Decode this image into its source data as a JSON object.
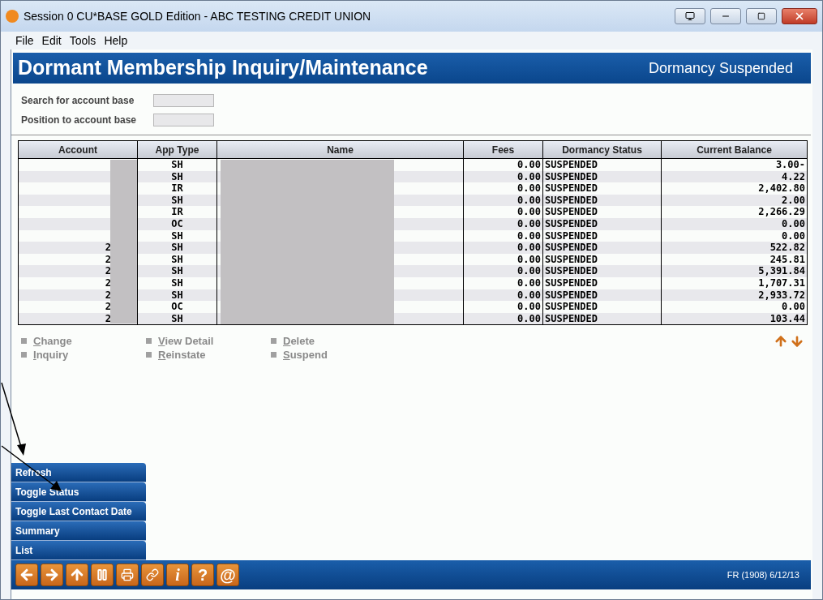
{
  "window": {
    "title": "Session 0 CU*BASE GOLD Edition - ABC TESTING CREDIT UNION"
  },
  "menu": [
    "File",
    "Edit",
    "Tools",
    "Help"
  ],
  "header": {
    "title": "Dormant Membership Inquiry/Maintenance",
    "mode": "Dormancy Suspended"
  },
  "fields": [
    {
      "label": "Search for account base"
    },
    {
      "label": "Position to account base"
    }
  ],
  "table": {
    "columns": [
      "Account",
      "App Type",
      "Name",
      "Fees",
      "Dormancy Status",
      "Current Balance"
    ],
    "rows": [
      {
        "app_type": "SH",
        "fees": "0.00",
        "status": "SUSPENDED",
        "balance": "3.00-"
      },
      {
        "app_type": "SH",
        "fees": "0.00",
        "status": "SUSPENDED",
        "balance": "4.22"
      },
      {
        "app_type": "IR",
        "fees": "0.00",
        "status": "SUSPENDED",
        "balance": "2,402.80"
      },
      {
        "app_type": "SH",
        "fees": "0.00",
        "status": "SUSPENDED",
        "balance": "2.00"
      },
      {
        "app_type": "IR",
        "fees": "0.00",
        "status": "SUSPENDED",
        "balance": "2,266.29"
      },
      {
        "app_type": "OC",
        "fees": "0.00",
        "status": "SUSPENDED",
        "balance": "0.00"
      },
      {
        "app_type": "SH",
        "fees": "0.00",
        "status": "SUSPENDED",
        "balance": "0.00"
      },
      {
        "account": "2",
        "app_type": "SH",
        "fees": "0.00",
        "status": "SUSPENDED",
        "balance": "522.82"
      },
      {
        "account": "2",
        "app_type": "SH",
        "fees": "0.00",
        "status": "SUSPENDED",
        "balance": "245.81"
      },
      {
        "account": "2",
        "app_type": "SH",
        "fees": "0.00",
        "status": "SUSPENDED",
        "balance": "5,391.84"
      },
      {
        "account": "2",
        "app_type": "SH",
        "fees": "0.00",
        "status": "SUSPENDED",
        "balance": "1,707.31"
      },
      {
        "account": "2",
        "app_type": "SH",
        "fees": "0.00",
        "status": "SUSPENDED",
        "balance": "2,933.72"
      },
      {
        "account": "2",
        "app_type": "OC",
        "fees": "0.00",
        "status": "SUSPENDED",
        "balance": "0.00"
      },
      {
        "account": "2",
        "app_type": "SH",
        "fees": "0.00",
        "status": "SUSPENDED",
        "balance": "103.44"
      }
    ]
  },
  "actions": [
    [
      "Change",
      "Inquiry"
    ],
    [
      "View Detail",
      "Reinstate"
    ],
    [
      "Delete",
      "Suspend"
    ]
  ],
  "function_buttons": [
    "Refresh",
    "Toggle Status",
    "Toggle Last Contact Date",
    "Summary",
    "List"
  ],
  "toolbar_glyphs": [
    "i",
    "?",
    "@"
  ],
  "status": "FR (1908) 6/12/13"
}
